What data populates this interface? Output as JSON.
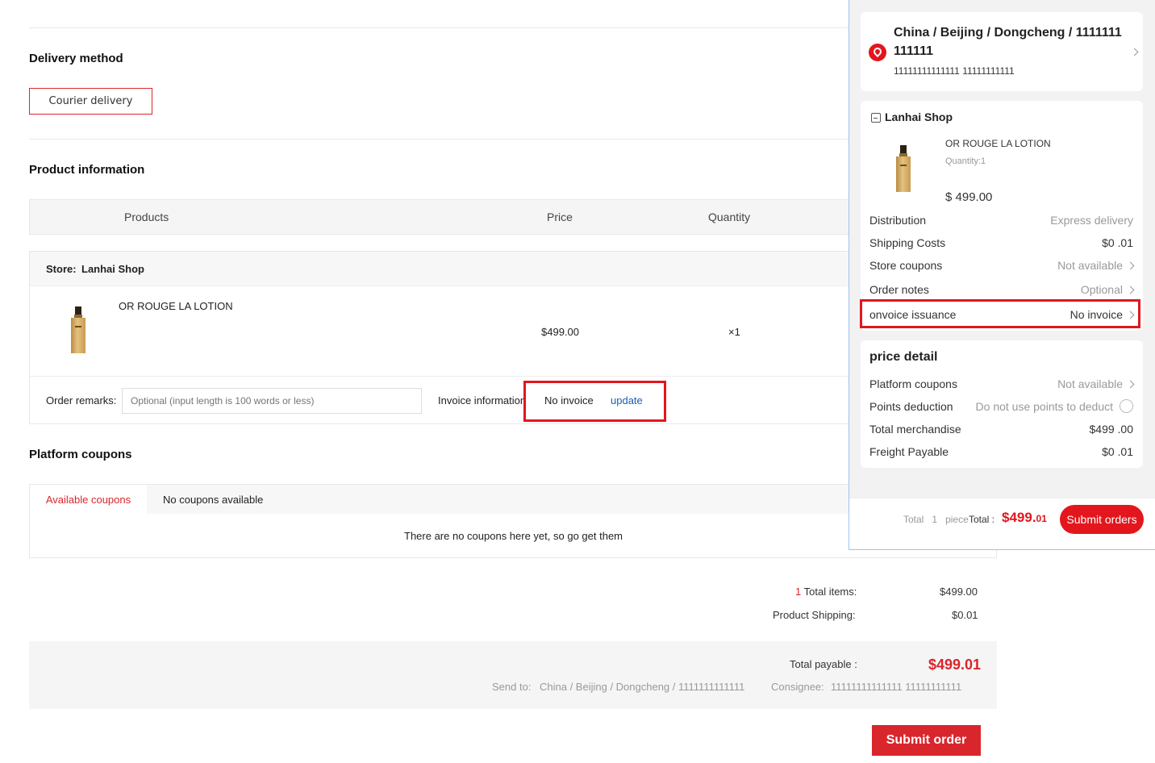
{
  "delivery": {
    "title": "Delivery method",
    "option": "Courier delivery"
  },
  "product_info": {
    "title": "Product information",
    "columns": [
      "Products",
      "Price",
      "Quantity"
    ],
    "store_label": "Store:",
    "store_name": "Lanhai Shop",
    "item": {
      "name": "OR ROUGE LA LOTION",
      "price": "$499.00",
      "quantity": "×1"
    },
    "remarks_label": "Order remarks:",
    "remarks_placeholder": "Optional (input length is 100 words or less)",
    "invoice_label": "Invoice information",
    "invoice_value": "No invoice",
    "invoice_update": "update"
  },
  "coupons": {
    "title": "Platform coupons",
    "tab_active": "Available coupons",
    "tab_other": "No coupons available",
    "empty_text": "There are no coupons here yet, so go get them"
  },
  "summary": {
    "count": "1",
    "total_items_label": "Total items:",
    "total_items_value": "$499.00",
    "shipping_label": "Product Shipping:",
    "shipping_value": "$0.01",
    "payable_label": "Total payable :",
    "payable_value": "$499.01",
    "send_to_label": "Send to:",
    "send_to_value": "China / Beijing / Dongcheng / 1111111111111",
    "consignee_label": "Consignee:",
    "consignee_value": "11111111111111 11111111111",
    "submit": "Submit order"
  },
  "panel": {
    "address_line1": "China / Beijing / Dongcheng / 1111111",
    "address_line2": "111111",
    "address_contact": "11111111111111 11111111111",
    "shop_name": "Lanhai Shop",
    "item_name": "OR ROUGE LA LOTION",
    "item_qty": "Quantity:1",
    "item_price": "$ 499.00",
    "rows": {
      "distribution": {
        "k": "Distribution",
        "v": "Express delivery"
      },
      "shipping": {
        "k": "Shipping Costs",
        "v": "$0 .01"
      },
      "store_coupons": {
        "k": "Store coupons",
        "v": "Not available"
      },
      "order_notes": {
        "k": "Order notes",
        "v": "Optional"
      },
      "invoice": {
        "k": "onvoice issuance",
        "v": "No invoice"
      }
    },
    "price_detail_title": "price detail",
    "price_rows": {
      "platform_coupons": {
        "k": "Platform coupons",
        "v": "Not available"
      },
      "points": {
        "k": "Points deduction",
        "v": "Do not use points to deduct"
      },
      "merch": {
        "k": "Total merchandise",
        "v": "$499 .00"
      },
      "freight": {
        "k": "Freight Payable",
        "v": "$0 .01"
      }
    },
    "footer_total": "Total",
    "footer_count": "1",
    "footer_piece": "piece",
    "footer_total2": "Total :",
    "footer_amount_main": "$499.",
    "footer_amount_dec": "01",
    "submit": "Submit orders"
  },
  "colors": {
    "accent": "#d9262c",
    "highlight_frame": "#e3161d",
    "panel_border": "#9ec2ee",
    "link": "#1a5fb4"
  }
}
